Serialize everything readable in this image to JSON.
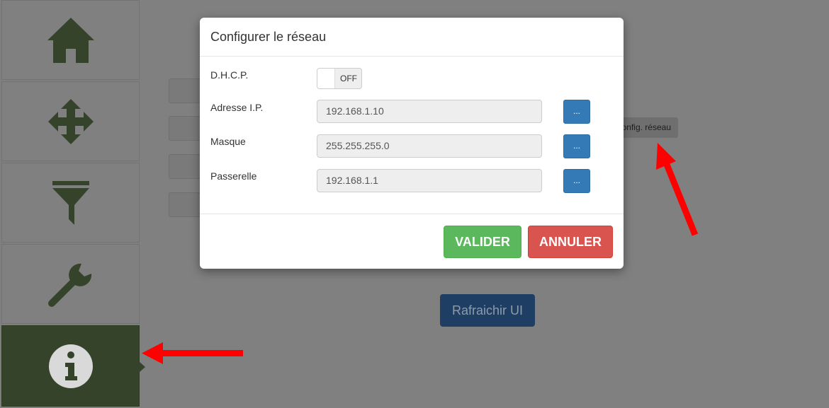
{
  "sidebar": {
    "items": [
      {
        "icon": "home-icon"
      },
      {
        "icon": "move-icon"
      },
      {
        "icon": "filter-icon"
      },
      {
        "icon": "wrench-icon"
      },
      {
        "icon": "info-icon",
        "active": true
      }
    ]
  },
  "background": {
    "config_label": "onfig. réseau",
    "refresh_label": "Rafraichir UI"
  },
  "modal": {
    "title": "Configurer le réseau",
    "dhcp": {
      "label": "D.H.C.P.",
      "state": "OFF"
    },
    "ip": {
      "label": "Adresse I.P.",
      "value": "192.168.1.10",
      "button": "..."
    },
    "mask": {
      "label": "Masque",
      "value": "255.255.255.0",
      "button": "..."
    },
    "gateway": {
      "label": "Passerelle",
      "value": "192.168.1.1",
      "button": "..."
    },
    "validate_label": "VALIDER",
    "cancel_label": "ANNULER"
  },
  "colors": {
    "sidebar_active": "#36432b",
    "icon": "#36432b",
    "validate": "#5cb85c",
    "cancel": "#d9534f",
    "primary": "#337ab7",
    "annotation_arrow": "#ff0000"
  }
}
